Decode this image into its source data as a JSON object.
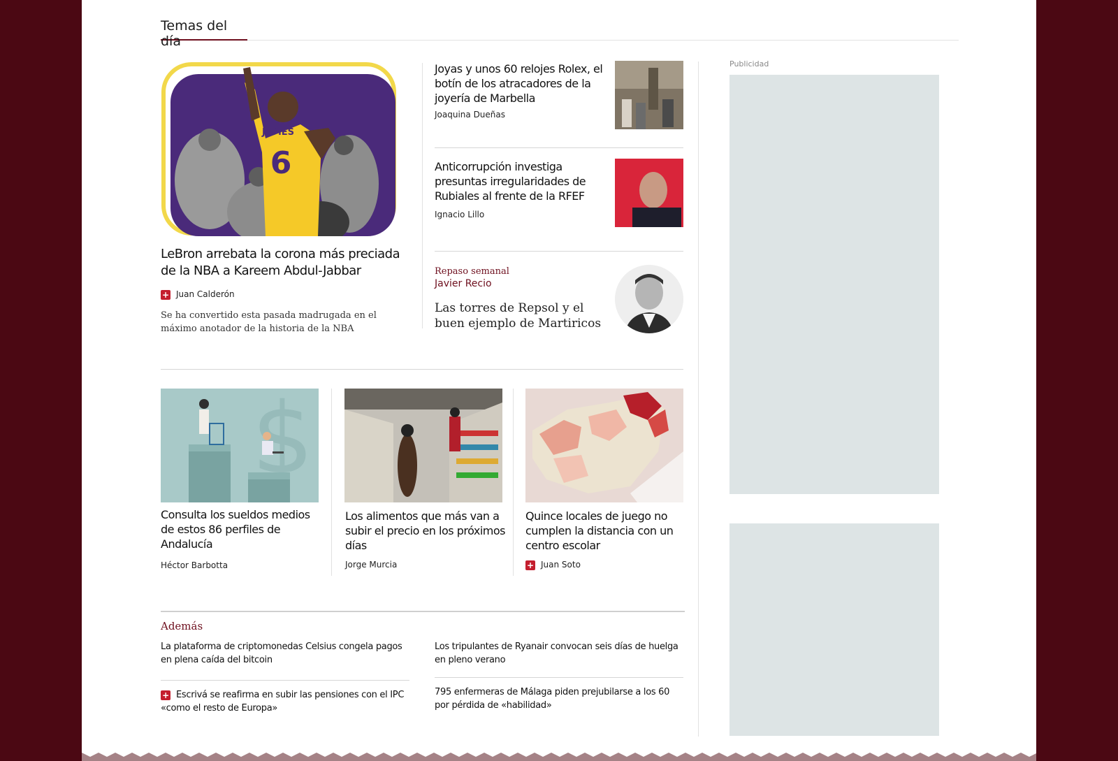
{
  "section": {
    "title": "Temas del día"
  },
  "lead": {
    "headline": "LeBron arrebata la corona más preciada de la NBA a Kareem Abdul-Jabbar",
    "author": "Juan Calderón",
    "summary": "Se ha convertido esta pasada madrugada en el máximo anotador de la historia de la NBA",
    "jersey_name": "JAMES",
    "jersey_number": "6"
  },
  "side_stories": [
    {
      "headline": "Joyas y unos 60 relojes Rolex, el botín de los atracadores de la joyería de Marbella",
      "author": "Joaquina Dueñas"
    },
    {
      "headline": "Anticorrupción investiga presuntas irregularidades de Rubiales al frente de la RFEF",
      "author": "Ignacio Lillo"
    }
  ],
  "opinion": {
    "section": "Repaso semanal",
    "columnist": "Javier Recio",
    "headline": "Las torres de Repsol y el buen ejemplo de Martiricos"
  },
  "grid_stories": [
    {
      "headline": "Consulta los sueldos medios de estos 86 perfiles de Andalucía",
      "author": "Héctor Barbotta",
      "premium": false
    },
    {
      "headline": "Los alimentos que más van a subir el precio en los próximos días",
      "author": "Jorge Murcia",
      "premium": false
    },
    {
      "headline": "Quince locales de juego no cumplen la distancia con un centro escolar",
      "author": "Juan Soto",
      "premium": true
    }
  ],
  "ademas": {
    "title": "Además",
    "items": [
      {
        "text": "La plataforma de criptomonedas Celsius congela pagos en plena caída del bitcoin",
        "premium": false
      },
      {
        "text": "Los tripulantes de Ryanair convocan seis días de huelga en pleno verano",
        "premium": false
      },
      {
        "text": "Escrivá se reafirma en subir las pensiones con el IPC «como el resto de Europa»",
        "premium": true
      },
      {
        "text": "795 enfermeras de Málaga piden prejubilarse a los 60 por pérdida de «habilidad»",
        "premium": false
      }
    ]
  },
  "ad": {
    "label": "Publicidad"
  },
  "colors": {
    "brand": "#6e0f1e",
    "background": "#4b0813",
    "premium": "#c41e2e",
    "ad_box": "#dde4e5"
  }
}
